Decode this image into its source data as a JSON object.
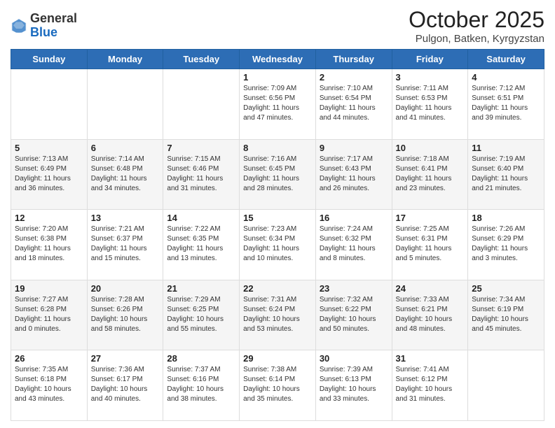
{
  "header": {
    "logo_general": "General",
    "logo_blue": "Blue",
    "month_title": "October 2025",
    "subtitle": "Pulgon, Batken, Kyrgyzstan"
  },
  "weekdays": [
    "Sunday",
    "Monday",
    "Tuesday",
    "Wednesday",
    "Thursday",
    "Friday",
    "Saturday"
  ],
  "weeks": [
    [
      {
        "day": "",
        "info": ""
      },
      {
        "day": "",
        "info": ""
      },
      {
        "day": "",
        "info": ""
      },
      {
        "day": "1",
        "info": "Sunrise: 7:09 AM\nSunset: 6:56 PM\nDaylight: 11 hours and 47 minutes."
      },
      {
        "day": "2",
        "info": "Sunrise: 7:10 AM\nSunset: 6:54 PM\nDaylight: 11 hours and 44 minutes."
      },
      {
        "day": "3",
        "info": "Sunrise: 7:11 AM\nSunset: 6:53 PM\nDaylight: 11 hours and 41 minutes."
      },
      {
        "day": "4",
        "info": "Sunrise: 7:12 AM\nSunset: 6:51 PM\nDaylight: 11 hours and 39 minutes."
      }
    ],
    [
      {
        "day": "5",
        "info": "Sunrise: 7:13 AM\nSunset: 6:49 PM\nDaylight: 11 hours and 36 minutes."
      },
      {
        "day": "6",
        "info": "Sunrise: 7:14 AM\nSunset: 6:48 PM\nDaylight: 11 hours and 34 minutes."
      },
      {
        "day": "7",
        "info": "Sunrise: 7:15 AM\nSunset: 6:46 PM\nDaylight: 11 hours and 31 minutes."
      },
      {
        "day": "8",
        "info": "Sunrise: 7:16 AM\nSunset: 6:45 PM\nDaylight: 11 hours and 28 minutes."
      },
      {
        "day": "9",
        "info": "Sunrise: 7:17 AM\nSunset: 6:43 PM\nDaylight: 11 hours and 26 minutes."
      },
      {
        "day": "10",
        "info": "Sunrise: 7:18 AM\nSunset: 6:41 PM\nDaylight: 11 hours and 23 minutes."
      },
      {
        "day": "11",
        "info": "Sunrise: 7:19 AM\nSunset: 6:40 PM\nDaylight: 11 hours and 21 minutes."
      }
    ],
    [
      {
        "day": "12",
        "info": "Sunrise: 7:20 AM\nSunset: 6:38 PM\nDaylight: 11 hours and 18 minutes."
      },
      {
        "day": "13",
        "info": "Sunrise: 7:21 AM\nSunset: 6:37 PM\nDaylight: 11 hours and 15 minutes."
      },
      {
        "day": "14",
        "info": "Sunrise: 7:22 AM\nSunset: 6:35 PM\nDaylight: 11 hours and 13 minutes."
      },
      {
        "day": "15",
        "info": "Sunrise: 7:23 AM\nSunset: 6:34 PM\nDaylight: 11 hours and 10 minutes."
      },
      {
        "day": "16",
        "info": "Sunrise: 7:24 AM\nSunset: 6:32 PM\nDaylight: 11 hours and 8 minutes."
      },
      {
        "day": "17",
        "info": "Sunrise: 7:25 AM\nSunset: 6:31 PM\nDaylight: 11 hours and 5 minutes."
      },
      {
        "day": "18",
        "info": "Sunrise: 7:26 AM\nSunset: 6:29 PM\nDaylight: 11 hours and 3 minutes."
      }
    ],
    [
      {
        "day": "19",
        "info": "Sunrise: 7:27 AM\nSunset: 6:28 PM\nDaylight: 11 hours and 0 minutes."
      },
      {
        "day": "20",
        "info": "Sunrise: 7:28 AM\nSunset: 6:26 PM\nDaylight: 10 hours and 58 minutes."
      },
      {
        "day": "21",
        "info": "Sunrise: 7:29 AM\nSunset: 6:25 PM\nDaylight: 10 hours and 55 minutes."
      },
      {
        "day": "22",
        "info": "Sunrise: 7:31 AM\nSunset: 6:24 PM\nDaylight: 10 hours and 53 minutes."
      },
      {
        "day": "23",
        "info": "Sunrise: 7:32 AM\nSunset: 6:22 PM\nDaylight: 10 hours and 50 minutes."
      },
      {
        "day": "24",
        "info": "Sunrise: 7:33 AM\nSunset: 6:21 PM\nDaylight: 10 hours and 48 minutes."
      },
      {
        "day": "25",
        "info": "Sunrise: 7:34 AM\nSunset: 6:19 PM\nDaylight: 10 hours and 45 minutes."
      }
    ],
    [
      {
        "day": "26",
        "info": "Sunrise: 7:35 AM\nSunset: 6:18 PM\nDaylight: 10 hours and 43 minutes."
      },
      {
        "day": "27",
        "info": "Sunrise: 7:36 AM\nSunset: 6:17 PM\nDaylight: 10 hours and 40 minutes."
      },
      {
        "day": "28",
        "info": "Sunrise: 7:37 AM\nSunset: 6:16 PM\nDaylight: 10 hours and 38 minutes."
      },
      {
        "day": "29",
        "info": "Sunrise: 7:38 AM\nSunset: 6:14 PM\nDaylight: 10 hours and 35 minutes."
      },
      {
        "day": "30",
        "info": "Sunrise: 7:39 AM\nSunset: 6:13 PM\nDaylight: 10 hours and 33 minutes."
      },
      {
        "day": "31",
        "info": "Sunrise: 7:41 AM\nSunset: 6:12 PM\nDaylight: 10 hours and 31 minutes."
      },
      {
        "day": "",
        "info": ""
      }
    ]
  ]
}
